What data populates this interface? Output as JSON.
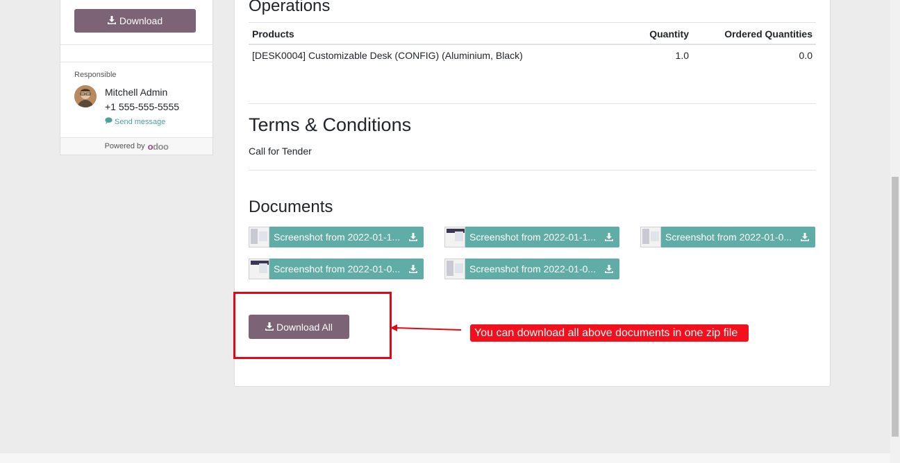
{
  "sidebar": {
    "download_label": "Download",
    "responsible_label": "Responsible",
    "responsible_name": "Mitchell Admin",
    "responsible_phone": "+1 555-555-5555",
    "send_message_label": "Send message",
    "powered_by_label": "Powered by",
    "powered_logo_o": "o",
    "powered_logo_doo": "doo"
  },
  "operations": {
    "title": "Operations",
    "headers": [
      "Products",
      "Quantity",
      "Ordered Quantities"
    ],
    "rows": [
      [
        "[DESK0004] Customizable Desk (CONFIG) (Aluminium, Black)",
        "1.0",
        "0.0"
      ]
    ]
  },
  "terms": {
    "title": "Terms & Conditions",
    "text": "Call for Tender"
  },
  "documents": {
    "title": "Documents",
    "items": [
      "Screenshot from 2022-01-1...",
      "Screenshot from 2022-01-1...",
      "Screenshot from 2022-01-0...",
      "Screenshot from 2022-01-0...",
      "Screenshot from 2022-01-0..."
    ],
    "download_all_label": "Download All"
  },
  "annotation": {
    "callout_text": "You can download all above documents in one zip file",
    "color": "#f40f1d"
  },
  "colors": {
    "primary": "#7c6476",
    "doc_teal": "#5fada6",
    "link": "#4aa39a"
  },
  "icons": {
    "download": "download-icon",
    "chat": "chat-bubble-icon"
  }
}
